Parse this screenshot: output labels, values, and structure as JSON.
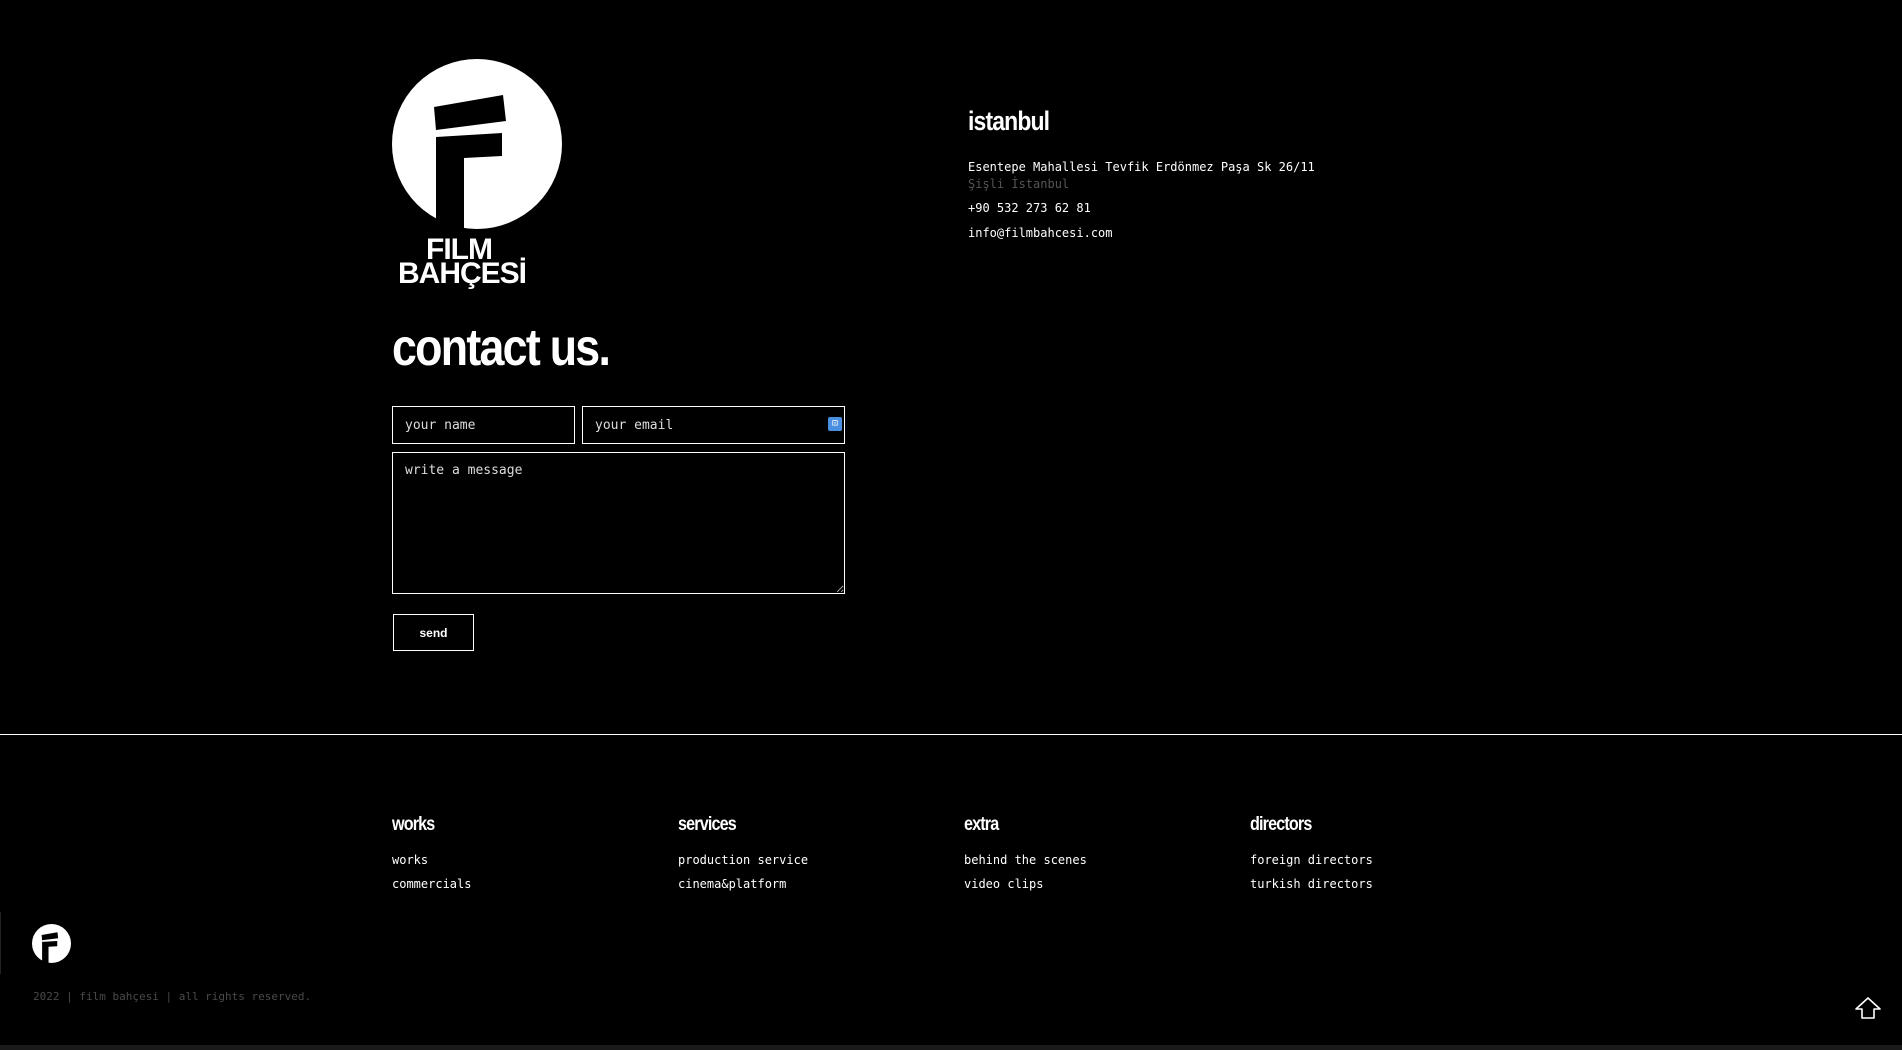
{
  "logo": {
    "line1": "FILM",
    "line2": "BAHÇESİ"
  },
  "contact": {
    "heading": "contact us.",
    "name_placeholder": "your name",
    "email_placeholder": "your email",
    "message_placeholder": "write a message",
    "send_label": "send"
  },
  "office": {
    "city": "istanbul",
    "address_line1": "Esentepe Mahallesi Tevfik Erdönmez Paşa Sk 26/11",
    "address_line2": "Şişli İstanbul",
    "phone": "+90 532 273 62 81",
    "email": "info@filmbahcesi.com"
  },
  "footer": {
    "columns": [
      {
        "title": "works",
        "links": [
          "works",
          "commercials"
        ]
      },
      {
        "title": "services",
        "links": [
          "production service",
          "cinema&platform"
        ]
      },
      {
        "title": "extra",
        "links": [
          "behind the scenes",
          "video clips"
        ]
      },
      {
        "title": "directors",
        "links": [
          "foreign directors",
          "turkish directors"
        ]
      }
    ],
    "copyright": "2022 | film bahçesi | all rights reserved."
  },
  "icons": {
    "logo": "film-bahcesi-logo-icon",
    "password": "password-manager-icon",
    "scroll_top": "arrow-up-icon"
  }
}
